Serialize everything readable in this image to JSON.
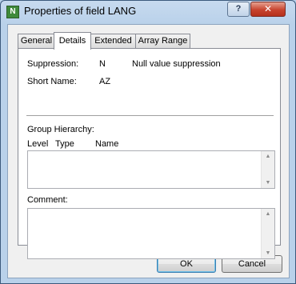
{
  "window": {
    "title": "Properties of field LANG",
    "app_icon_letter": "N",
    "help_button": "?",
    "close_button": "✕"
  },
  "tabs": [
    {
      "label": "General",
      "active": false
    },
    {
      "label": "Details",
      "active": true
    },
    {
      "label": "Extended",
      "active": false
    },
    {
      "label": "Array Range",
      "active": false
    }
  ],
  "details": {
    "suppression_label": "Suppression:",
    "suppression_value": "N",
    "suppression_desc": "Null value suppression",
    "short_name_label": "Short Name:",
    "short_name_value": "AZ",
    "group_hierarchy_label": "Group Hierarchy:",
    "columns": [
      "Level",
      "Type",
      "Name"
    ],
    "comment_label": "Comment:"
  },
  "buttons": {
    "ok": "OK",
    "cancel": "Cancel"
  }
}
